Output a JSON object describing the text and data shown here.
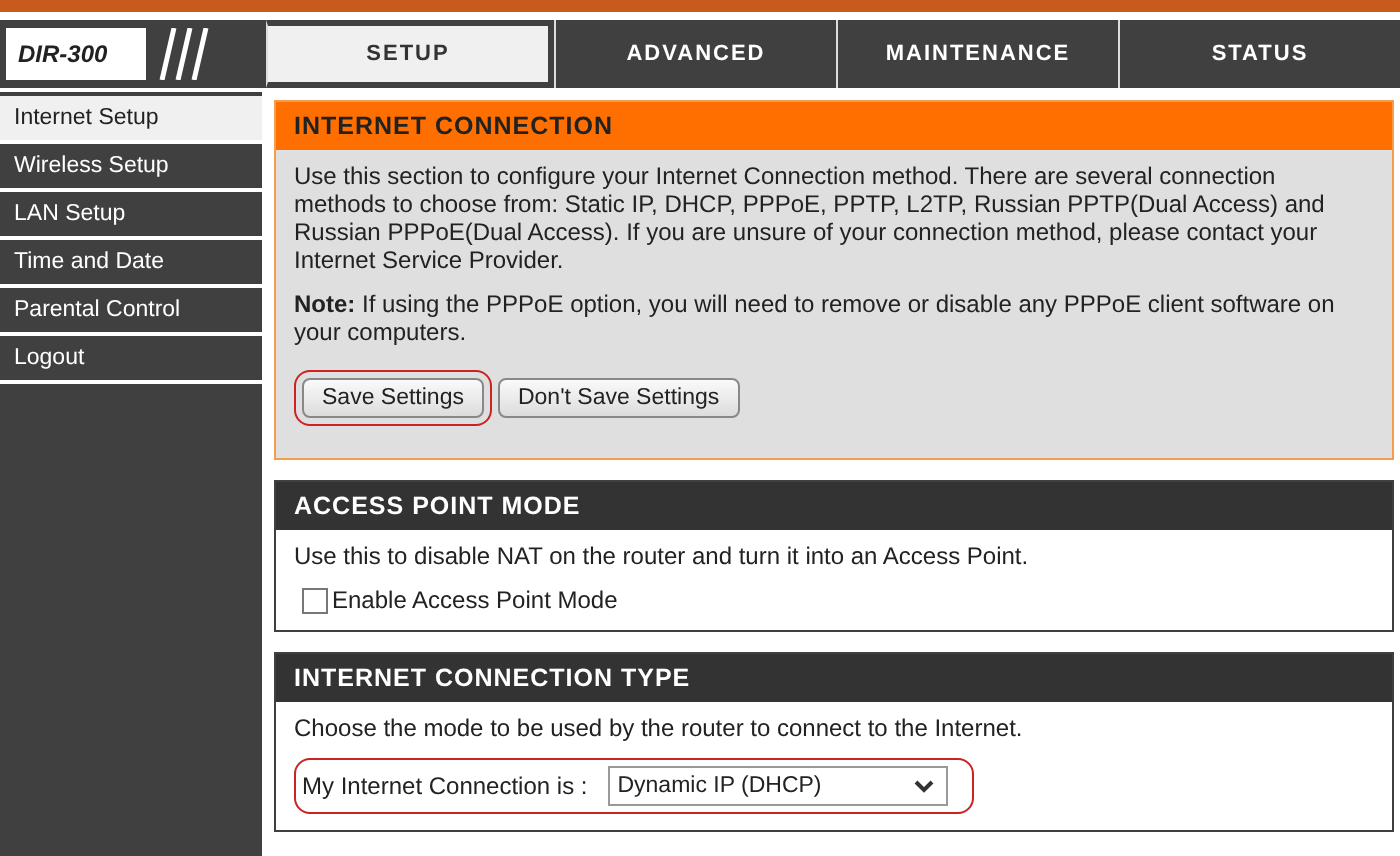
{
  "logo": {
    "model": "DIR-300"
  },
  "tabs": [
    {
      "label": "SETUP",
      "selected": true
    },
    {
      "label": "ADVANCED",
      "selected": false
    },
    {
      "label": "MAINTENANCE",
      "selected": false
    },
    {
      "label": "STATUS",
      "selected": false
    }
  ],
  "sidebar": {
    "items": [
      {
        "label": "Internet Setup",
        "selected": true
      },
      {
        "label": "Wireless Setup",
        "selected": false
      },
      {
        "label": "LAN Setup",
        "selected": false
      },
      {
        "label": "Time and Date",
        "selected": false
      },
      {
        "label": "Parental Control",
        "selected": false
      },
      {
        "label": "Logout",
        "selected": false
      }
    ]
  },
  "internet_connection": {
    "title": "INTERNET CONNECTION",
    "description": "Use this section to configure your Internet Connection method. There are several connection methods to choose from: Static IP, DHCP, PPPoE, PPTP, L2TP, Russian PPTP(Dual Access) and Russian PPPoE(Dual Access). If you are unsure of your connection method, please contact your Internet Service Provider.",
    "note": "**Note:** If using the PPPoE option, you will need to remove or disable any PPPoE client software on your computers.",
    "buttons": [
      {
        "label": "Save Settings",
        "highlighted": true
      },
      {
        "label": "Don't Save Settings",
        "highlighted": false
      }
    ]
  },
  "access_point_mode": {
    "title": "ACCESS POINT MODE",
    "description": "Use this to disable NAT on the router and turn it into an Access Point.",
    "checkbox": {
      "label": "Enable Access Point Mode",
      "checked": false
    }
  },
  "internet_connection_type": {
    "title": "INTERNET CONNECTION TYPE",
    "description": "Choose the mode to be used by the router to connect to the Internet.",
    "field": {
      "label": "My Internet Connection is :",
      "value": "Dynamic IP (DHCP)",
      "highlighted": true
    }
  }
}
